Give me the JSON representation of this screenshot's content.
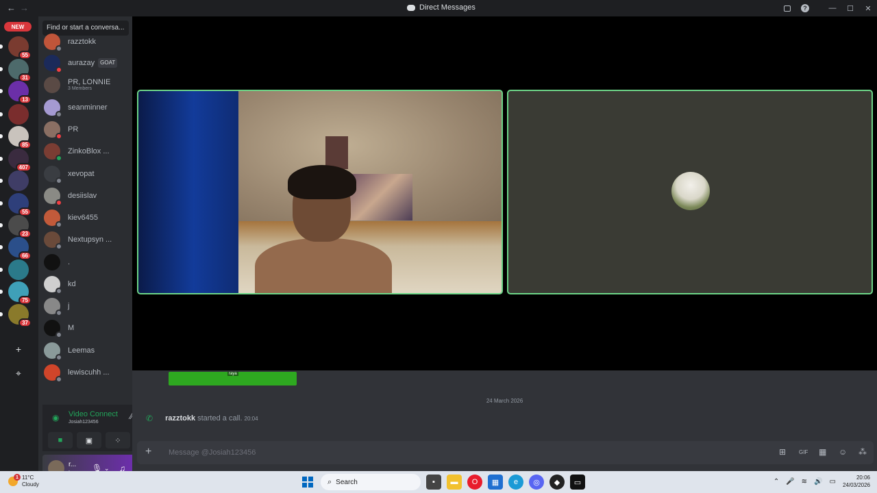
{
  "titlebar": {
    "back": "←",
    "forward": "→",
    "title": "Direct Messages",
    "inbox_icon": "inbox-icon",
    "help": "?",
    "minimize": "—",
    "maximize": "☐",
    "close": "✕"
  },
  "servers": {
    "new_label": "NEW",
    "items": [
      {
        "badge": "68",
        "color": "#5a2a2a"
      },
      {
        "badge": "55",
        "color": "#7a3b30"
      },
      {
        "badge": "31",
        "color": "#4d6a6b"
      },
      {
        "badge": "13",
        "color": "#6b2fa8"
      },
      {
        "badge": "",
        "color": "#7a2d2d"
      },
      {
        "badge": "85",
        "color": "#c9c3bd"
      },
      {
        "badge": "407",
        "color": "#3a2b3f"
      },
      {
        "badge": "",
        "color": "#3f3d66"
      },
      {
        "badge": "55",
        "color": "#2e3f7a"
      },
      {
        "badge": "23",
        "color": "#4b4b4b"
      },
      {
        "badge": "66",
        "color": "#2b4f8a"
      },
      {
        "badge": "",
        "color": "#2b7a8a"
      },
      {
        "badge": "75",
        "color": "#3fa0b8"
      },
      {
        "badge": "37",
        "color": "#8a7a2b"
      }
    ],
    "add": "+",
    "discover": "⌖"
  },
  "dm": {
    "search_placeholder": "Find or start a conversa...",
    "items": [
      {
        "name": "razztokk",
        "sub": "",
        "avatar": "#c0553a",
        "status": "#80848e"
      },
      {
        "name": "aurazay",
        "sub": "",
        "avatar": "#1b2a5a",
        "status": "#f23f43",
        "tag": "GOAT"
      },
      {
        "name": "PR, LONNIE",
        "sub": "3 Members",
        "avatar": "#5a4a45",
        "status": ""
      },
      {
        "name": "seanminner",
        "sub": "",
        "avatar": "#a59ad2",
        "status": "#80848e"
      },
      {
        "name": "PR",
        "sub": "",
        "avatar": "#8a6f63",
        "status": "#f23f43"
      },
      {
        "name": "ZinkoBlox ...",
        "sub": "",
        "avatar": "#7a3d33",
        "status": "#23a55a"
      },
      {
        "name": "xevopat",
        "sub": "",
        "avatar": "#3a3d42",
        "status": "#80848e"
      },
      {
        "name": "desiislav",
        "sub": "",
        "avatar": "#8a8a85",
        "status": "#f23f43"
      },
      {
        "name": "kiev6455",
        "sub": "",
        "avatar": "#c25a3a",
        "status": "#80848e"
      },
      {
        "name": "Nextupsyn ...",
        "sub": "",
        "avatar": "#6a4a3a",
        "status": "#80848e"
      },
      {
        "name": ".",
        "sub": "",
        "avatar": "#111111",
        "status": ""
      },
      {
        "name": "kd",
        "sub": "",
        "avatar": "#cfcfcf",
        "status": "#80848e"
      },
      {
        "name": "j",
        "sub": "",
        "avatar": "#888888",
        "status": "#80848e"
      },
      {
        "name": "M",
        "sub": "",
        "avatar": "#111111",
        "status": "#80848e"
      },
      {
        "name": "Leemas",
        "sub": "",
        "avatar": "#8a9a9a",
        "status": "#80848e"
      },
      {
        "name": "lewiscuhh ...",
        "sub": "",
        "avatar": "#d0452a",
        "status": "#80848e"
      }
    ]
  },
  "voice": {
    "title": "Video Connect",
    "sub": "Josiah123456"
  },
  "user": {
    "name": "r...",
    "status": "In"
  },
  "chat": {
    "gif_label": "raya",
    "date": "24 March 2026",
    "caller": "razztokk",
    "message": "started a call.",
    "time": "20:04",
    "placeholder": "Message @Josiah123456"
  },
  "taskbar": {
    "weather_badge": "1",
    "temp": "11°C",
    "condition": "Cloudy",
    "search": "Search",
    "time": "20:06",
    "date": "24/03/2026"
  }
}
